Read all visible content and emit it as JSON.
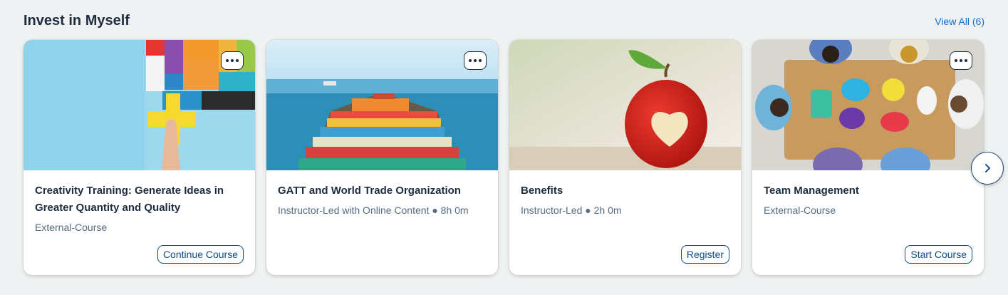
{
  "section": {
    "title": "Invest in Myself",
    "view_all": "View All (6)"
  },
  "cards": [
    {
      "title": "Creativity Training: Generate Ideas in Greater Quantity and Quality",
      "subtitle": "External-Course",
      "button": "Continue Course",
      "image": "puzzle-pieces-image",
      "has_more_menu": true
    },
    {
      "title": "GATT and World Trade Organization",
      "subtitle": "Instructor-Led with Online Content ● 8h 0m",
      "image": "container-ship-image",
      "has_more_menu": true
    },
    {
      "title": "Benefits",
      "subtitle": "Instructor-Led ● 2h 0m",
      "button": "Register",
      "image": "red-apple-heart-image",
      "has_more_menu": false
    },
    {
      "title": "Team Management",
      "subtitle": "External-Course",
      "button": "Start Course",
      "image": "team-meeting-table-image",
      "has_more_menu": true
    }
  ],
  "colors": {
    "accent": "#0a6ed1",
    "button_border": "#0a4b8a",
    "text": "#1d2d3e",
    "subtext": "#556b82",
    "background": "#eff1f2"
  },
  "icons": {
    "more": "ellipsis-icon",
    "next": "chevron-right-icon"
  }
}
